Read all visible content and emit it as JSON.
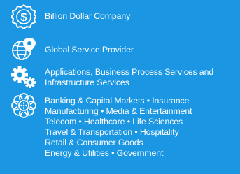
{
  "theme": {
    "background": "#1a96e2",
    "foreground": "#ffffff"
  },
  "items": [
    {
      "icon": "dollar-badge-icon",
      "lines": [
        "Billion Dollar Company"
      ]
    },
    {
      "icon": "globe-location-icon",
      "lines": [
        "Global Service Provider"
      ]
    },
    {
      "icon": "gears-icon",
      "lines": [
        "Applications, Business Process Services and",
        "Infrastructure Services"
      ]
    },
    {
      "icon": "industries-flower-icon",
      "lines": [
        "Banking & Capital Markets • Insurance",
        "Manufacturing • Media & Entertainment",
        "Telecom • Healthcare • Life Sciences",
        "Travel & Transportation • Hospitality",
        "Retail & Consumer Goods",
        "Energy & Utilities • Government"
      ]
    }
  ]
}
